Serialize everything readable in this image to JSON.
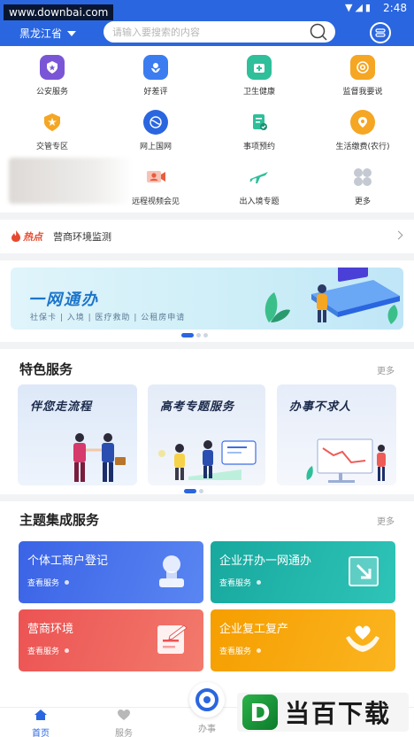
{
  "status_bar": {
    "time": "2:48"
  },
  "watermark": "www.downbai.com",
  "header": {
    "region": "黑龙江省",
    "search_placeholder": "请输入要搜索的内容"
  },
  "grid": {
    "items": [
      {
        "label": "公安服务",
        "icon": "police-badge-icon",
        "color": "#7a56d6"
      },
      {
        "label": "好差评",
        "icon": "flower-icon",
        "color": "#3b7cf0"
      },
      {
        "label": "卫生健康",
        "icon": "medical-kit-icon",
        "color": "#2fbf9a"
      },
      {
        "label": "监督我要说",
        "icon": "at-sign-icon",
        "color": "#f5a623"
      },
      {
        "label": "交管专区",
        "icon": "shield-star-icon",
        "color": "#f5a623"
      },
      {
        "label": "网上国网",
        "icon": "globe-icon",
        "color": "#2a66e0"
      },
      {
        "label": "事项预约",
        "icon": "doc-check-icon",
        "color": "#2fbf9a"
      },
      {
        "label": "生活缴费(农行)",
        "icon": "location-pin-icon",
        "color": "#f5a623"
      },
      {
        "label": "远程视频会见",
        "icon": "video-meeting-icon",
        "color": "#e85d3f"
      },
      {
        "label": "出入境专题",
        "icon": "airplane-icon",
        "color": "#2fbf9a"
      },
      {
        "label": "更多",
        "icon": "more-grid-icon",
        "color": "#b6bcc6"
      }
    ]
  },
  "hot": {
    "tag": "热点",
    "text": "营商环境监测"
  },
  "banner": {
    "title": "一网通办",
    "subtitle": "社保卡 | 入境 | 医疗救助 | 公租房申请"
  },
  "featured": {
    "title": "特色服务",
    "more": "更多",
    "cards": [
      {
        "title": "伴您走流程"
      },
      {
        "title": "高考专题服务"
      },
      {
        "title": "办事不求人"
      }
    ]
  },
  "theme": {
    "title": "主题集成服务",
    "more": "更多",
    "cards": [
      {
        "title": "个体工商户登记",
        "sub": "查看服务",
        "color": "#3d6ee8"
      },
      {
        "title": "企业开办一网通办",
        "sub": "查看服务",
        "color": "#1fb0a8"
      },
      {
        "title": "营商环境",
        "sub": "查看服务",
        "color": "#ef5b57"
      },
      {
        "title": "企业复工复产",
        "sub": "查看服务",
        "color": "#f6a300"
      }
    ]
  },
  "bottom_nav": {
    "items": [
      {
        "label": "首页"
      },
      {
        "label": "服务"
      },
      {
        "label": "办事"
      }
    ]
  },
  "brand_watermark": "当百下载"
}
